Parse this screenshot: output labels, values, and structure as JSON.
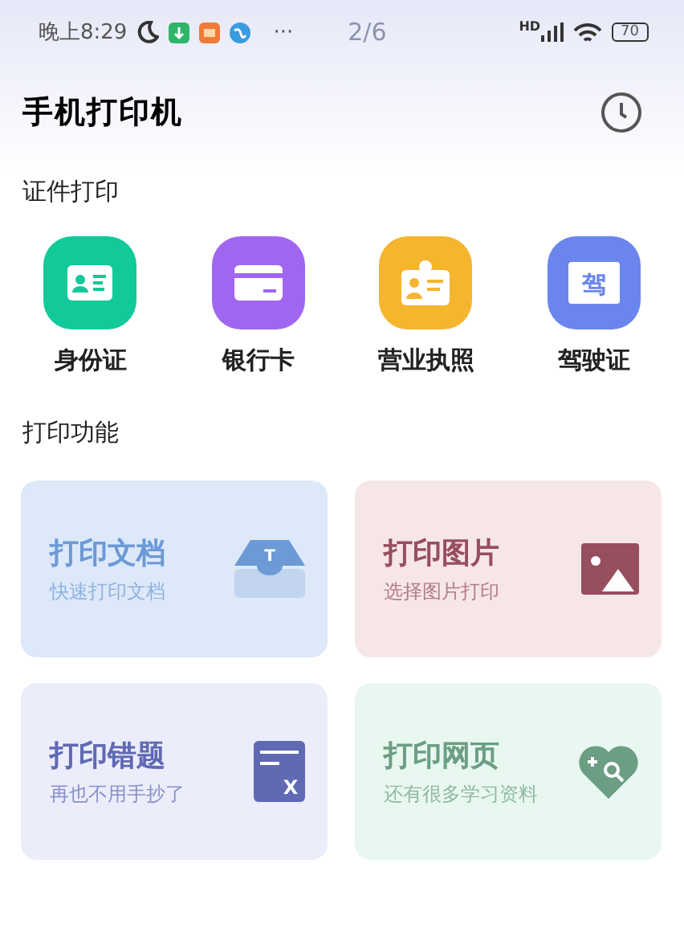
{
  "status_bar": {
    "time": "晚上8:29",
    "page_indicator": "2/6",
    "network": "HD",
    "battery": "70",
    "more": "···"
  },
  "header": {
    "title": "手机打印机"
  },
  "id_section": {
    "title": "证件打印",
    "items": [
      {
        "label": "身份证",
        "kind": "idcard",
        "color": "#12c99a"
      },
      {
        "label": "银行卡",
        "kind": "bankcard",
        "color": "#a066f0"
      },
      {
        "label": "营业执照",
        "kind": "license",
        "color": "#f5b52e"
      },
      {
        "label": "驾驶证",
        "kind": "driving",
        "color": "#6a86ee",
        "glyph": "驾"
      }
    ]
  },
  "print_section": {
    "title": "打印功能",
    "cards": [
      {
        "title": "打印文档",
        "subtitle": "快速打印文档",
        "kind": "document",
        "glyph": "T",
        "color": "#6b9ad6"
      },
      {
        "title": "打印图片",
        "subtitle": "选择图片打印",
        "kind": "image",
        "color": "#974e5e"
      },
      {
        "title": "打印错题",
        "subtitle": "再也不用手抄了",
        "kind": "mistakes",
        "glyph": "X",
        "color": "#5f69b4"
      },
      {
        "title": "打印网页",
        "subtitle": "还有很多学习资料",
        "kind": "web",
        "color": "#6b9e83"
      }
    ]
  }
}
